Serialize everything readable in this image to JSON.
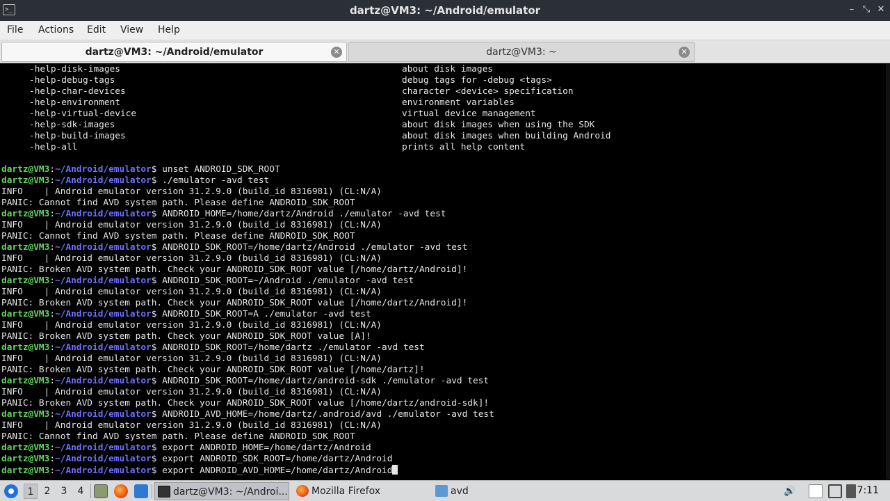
{
  "window": {
    "title": "dartz@VM3: ~/Android/emulator",
    "icon": "terminal-icon"
  },
  "menu": [
    "File",
    "Actions",
    "Edit",
    "View",
    "Help"
  ],
  "tabs": [
    {
      "label": "dartz@VM3: ~/Android/emulator",
      "active": true
    },
    {
      "label": "dartz@VM3: ~",
      "active": false
    }
  ],
  "terminal": {
    "help_rows": [
      {
        "option": "-help-disk-images",
        "desc": "about disk images"
      },
      {
        "option": "-help-debug-tags",
        "desc": "debug tags for -debug <tags>"
      },
      {
        "option": "-help-char-devices",
        "desc": "character <device> specification"
      },
      {
        "option": "-help-environment",
        "desc": "environment variables"
      },
      {
        "option": "-help-virtual-device",
        "desc": "virtual device management"
      },
      {
        "option": "-help-sdk-images",
        "desc": "about disk images when using the SDK"
      },
      {
        "option": "-help-build-images",
        "desc": "about disk images when building Android"
      },
      {
        "option": "-help-all",
        "desc": "prints all help content"
      }
    ],
    "prompt_user": "dartz@VM3",
    "prompt_sep": ":",
    "prompt_path": "~/Android/emulator",
    "prompt_sign": "$ ",
    "lines": [
      {
        "type": "cmd",
        "text": "unset ANDROID_SDK_ROOT"
      },
      {
        "type": "cmd",
        "text": "./emulator -avd test"
      },
      {
        "type": "out",
        "text": "INFO    | Android emulator version 31.2.9.0 (build_id 8316981) (CL:N/A)"
      },
      {
        "type": "out",
        "text": "PANIC: Cannot find AVD system path. Please define ANDROID_SDK_ROOT"
      },
      {
        "type": "cmd",
        "text": "ANDROID_HOME=/home/dartz/Android ./emulator -avd test"
      },
      {
        "type": "out",
        "text": "INFO    | Android emulator version 31.2.9.0 (build_id 8316981) (CL:N/A)"
      },
      {
        "type": "out",
        "text": "PANIC: Cannot find AVD system path. Please define ANDROID_SDK_ROOT"
      },
      {
        "type": "cmd",
        "text": "ANDROID_SDK_ROOT=/home/dartz/Android ./emulator -avd test"
      },
      {
        "type": "out",
        "text": "INFO    | Android emulator version 31.2.9.0 (build_id 8316981) (CL:N/A)"
      },
      {
        "type": "out",
        "text": "PANIC: Broken AVD system path. Check your ANDROID_SDK_ROOT value [/home/dartz/Android]!"
      },
      {
        "type": "cmd",
        "text": "ANDROID_SDK_ROOT=~/Android ./emulator -avd test"
      },
      {
        "type": "out",
        "text": "INFO    | Android emulator version 31.2.9.0 (build_id 8316981) (CL:N/A)"
      },
      {
        "type": "out",
        "text": "PANIC: Broken AVD system path. Check your ANDROID_SDK_ROOT value [/home/dartz/Android]!"
      },
      {
        "type": "cmd",
        "text": "ANDROID_SDK_ROOT=A ./emulator -avd test"
      },
      {
        "type": "out",
        "text": "INFO    | Android emulator version 31.2.9.0 (build_id 8316981) (CL:N/A)"
      },
      {
        "type": "out",
        "text": "PANIC: Broken AVD system path. Check your ANDROID_SDK_ROOT value [A]!"
      },
      {
        "type": "cmd",
        "text": "ANDROID_SDK_ROOT=/home/dartz ./emulator -avd test"
      },
      {
        "type": "out",
        "text": "INFO    | Android emulator version 31.2.9.0 (build_id 8316981) (CL:N/A)"
      },
      {
        "type": "out",
        "text": "PANIC: Broken AVD system path. Check your ANDROID_SDK_ROOT value [/home/dartz]!"
      },
      {
        "type": "cmd",
        "text": "ANDROID_SDK_ROOT=/home/dartz/android-sdk ./emulator -avd test"
      },
      {
        "type": "out",
        "text": "INFO    | Android emulator version 31.2.9.0 (build_id 8316981) (CL:N/A)"
      },
      {
        "type": "out",
        "text": "PANIC: Broken AVD system path. Check your ANDROID_SDK_ROOT value [/home/dartz/android-sdk]!"
      },
      {
        "type": "cmd",
        "text": "ANDROID_AVD_HOME=/home/dartz/.android/avd ./emulator -avd test"
      },
      {
        "type": "out",
        "text": "INFO    | Android emulator version 31.2.9.0 (build_id 8316981) (CL:N/A)"
      },
      {
        "type": "out",
        "text": "PANIC: Cannot find AVD system path. Please define ANDROID_SDK_ROOT"
      },
      {
        "type": "cmd",
        "text": "export ANDROID_HOME=/home/dartz/Android"
      },
      {
        "type": "cmd",
        "text": "export ANDROID_SDK_ROOT=/home/dartz/Android"
      },
      {
        "type": "cmd",
        "text": "export ANDROID_AVD_HOME=/home/dartz/Android",
        "cursor": true
      }
    ]
  },
  "taskbar": {
    "desktops": [
      "1",
      "2",
      "3",
      "4"
    ],
    "current_desktop": "1",
    "quick_launch": [
      "show-desktop-icon",
      "file-manager-icon",
      "firefox-icon",
      "window-icon"
    ],
    "tasks": [
      {
        "label": "dartz@VM3: ~/Androi...",
        "icon": "terminal-icon",
        "active": true
      },
      {
        "label": "Mozilla Firefox",
        "icon": "firefox-icon",
        "active": false
      },
      {
        "label": "avd",
        "icon": "folder-icon",
        "active": false
      }
    ],
    "tray": [
      "volume-icon",
      "clipboard-icon",
      "display-icon",
      "network-icon"
    ],
    "clock": "7:11"
  },
  "colors": {
    "prompt_user": "#5fd95f",
    "prompt_path": "#6f6fff",
    "terminal_bg": "#000000",
    "terminal_fg": "#e6e6e6"
  }
}
